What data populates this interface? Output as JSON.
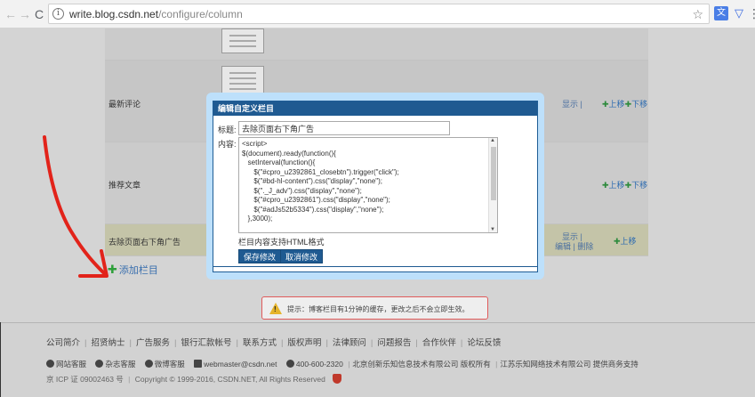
{
  "browser": {
    "url_host": "write.blog.csdn.net",
    "url_path": "/configure/column",
    "back": "←",
    "forward": "→",
    "reload": "C",
    "star": "☆",
    "translate": "文",
    "shield": "▽",
    "menu": "⋮"
  },
  "rows": [
    {
      "title": ""
    },
    {
      "title": "最新评论",
      "show": "显示",
      "sep": "|",
      "up": "上移",
      "down": "下移"
    },
    {
      "title": "推荐文章",
      "up": "上移",
      "down": "下移"
    },
    {
      "title": "去除页面右下角广告",
      "show": "显示",
      "sep": "|",
      "edit": "编辑",
      "delete": "删除",
      "up": "上移"
    }
  ],
  "add_column": "添加栏目",
  "modal": {
    "title": "编辑自定义栏目",
    "title_label": "标题:",
    "title_value": "去除页面右下角广告",
    "content_label": "内容:",
    "code_lines": [
      "<script>",
      "$(document).ready(function(){",
      "   setInterval(function(){",
      "      $(\"#cpro_u2392861_closebtn\").trigger(\"click\");",
      "      $(\"#bd-hl-content\").css(\"display\",\"none\");",
      "      $(\"._J_adv\").css(\"display\",\"none\");",
      "      $(\"#cpro_u2392861\").css(\"display\",\"none\");",
      "      $(\"#adJs52b5334\").css(\"display\",\"none\");",
      "   },3000);"
    ],
    "hint": "栏目内容支持HTML格式",
    "save": "保存修改",
    "cancel": "取消修改"
  },
  "warning": {
    "icon": "!",
    "text": "提示：博客栏目有1分钟的缓存，更改之后不会立即生效。"
  },
  "footer": {
    "links": [
      "公司简介",
      "招贤纳士",
      "广告服务",
      "银行汇款帐号",
      "联系方式",
      "版权声明",
      "法律顾问",
      "问题报告",
      "合作伙伴",
      "论坛反馈"
    ],
    "contacts": {
      "service": "网站客服",
      "magazine": "杂志客服",
      "weibo": "微博客服",
      "email": "webmaster@csdn.net",
      "phone": "400-600-2320",
      "company1": "北京创新乐知信息技术有限公司 版权所有",
      "company2": "江苏乐知网络技术有限公司 提供商务支持"
    },
    "icp": "京 ICP 证 09002463 号",
    "copyright": "Copyright © 1999-2016, CSDN.NET, All Rights Reserved"
  }
}
